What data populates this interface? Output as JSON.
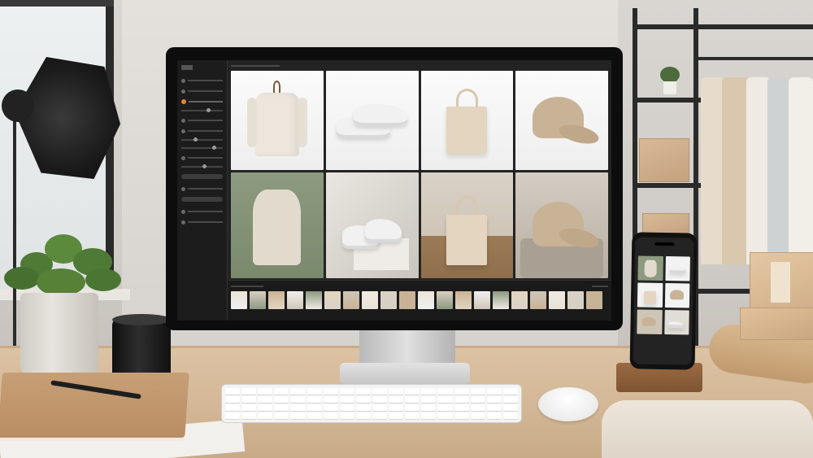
{
  "scene": {
    "description_tags": [
      "desk-setup",
      "monitor",
      "photo-editing-app",
      "smartphone",
      "keyboard",
      "mouse",
      "plant",
      "camera-lens",
      "notebook",
      "softbox",
      "clothing-rack"
    ]
  },
  "editor": {
    "grid_tiles": [
      {
        "subject": "sweatshirt",
        "background": "white"
      },
      {
        "subject": "sneakers",
        "background": "white"
      },
      {
        "subject": "tote-bag",
        "background": "white"
      },
      {
        "subject": "cap",
        "background": "white"
      },
      {
        "subject": "hoodie",
        "background": "green"
      },
      {
        "subject": "sneakers",
        "background": "studio"
      },
      {
        "subject": "tote-bag",
        "background": "room"
      },
      {
        "subject": "cap",
        "background": "stone"
      }
    ],
    "filmstrip_count": 20
  },
  "phone": {
    "title": ""
  },
  "colors": {
    "app_bg": "#232323",
    "sidebar_bg": "#1c1c1c",
    "accent": "#e0862f",
    "product_beige": "#e3d5c0",
    "hoodie_bg": "#8c9a7f"
  }
}
